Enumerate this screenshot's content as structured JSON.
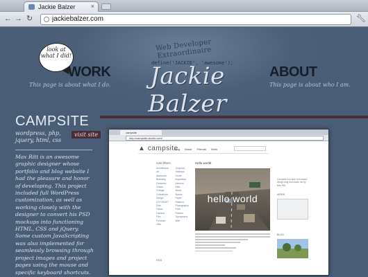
{
  "browser": {
    "tab_title": "Jackie Balzer",
    "tab_close": "×",
    "nav_back": "←",
    "nav_forward": "→",
    "nav_reload": "↻",
    "url": "jackiebalzer.com",
    "menu_icon": "wrench-icon"
  },
  "header": {
    "tagline": "Web Developer Extraordinaire",
    "code": "define('JACKIE', 'awesome');",
    "logo": "Jackie Balzer",
    "bubble_text": "look at what I did!"
  },
  "nav": {
    "work_label": "WORK",
    "work_sub": "This page is about what I do.",
    "about_label": "ABOUT",
    "about_sub": "This page is about who I am."
  },
  "project": {
    "title": "CAMPSITE",
    "tags": "wordpress, php, jquery, html, css",
    "visit_label": "visit site",
    "description": "Max Ritt is an awesome graphic designer whose portfolio and blog website I had the pleasure and honor of developing. This project included full WordPress customization, as well as working closely with the designer to convert his PSD mockups into functioning HTML, CSS and jQuery. Some custom JavaScripting was also implemented for seamlessly browsing through project images and project pages using the mouse and specific keyboard shortcuts."
  },
  "screenshot": {
    "tab_title": "campsite",
    "url": "http://campsite-studio.com/",
    "logo": "campsite",
    "menu": [
      "Blog",
      "About",
      "Friends",
      "Work"
    ],
    "sidebar_heading": "note filters",
    "sidebar_subheading": "RSS",
    "main_heading": "Hello world!",
    "photo_text": "hello world",
    "right_intro": "Campsite is a New York based design blog and studio run by Max Ritt.",
    "right_titles": [
      "WORK",
      "BLOG"
    ],
    "filters": [
      "Architecture",
      "Art",
      "Awesome",
      "Branding",
      "Ceramics",
      "Chairs",
      "Collage",
      "Collections",
      "Design",
      "DIY/CRAFT",
      "Dots",
      "Fabric",
      "Fashion",
      "Film",
      "Furniture",
      "Gifts",
      "Graphics",
      "Holidays",
      "Home",
      "Inspiration",
      "Interiors",
      "Kids",
      "Music",
      "Nature",
      "Paper",
      "Patterns",
      "Photography",
      "Print",
      "Posters",
      "Typography",
      "Web"
    ]
  },
  "colors": {
    "page_bg": "#4b5f78",
    "accent_bar": "#4b2d35",
    "logo_text": "#dde4ee"
  }
}
